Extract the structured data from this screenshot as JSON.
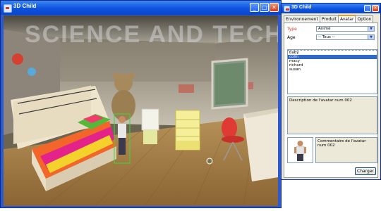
{
  "main_window": {
    "title": "3D Child",
    "watermark": "SCIENCE AND TECHNO"
  },
  "side_panel": {
    "title": "3D Child",
    "tabs": [
      "Environnement",
      "Produit",
      "Avatar",
      "Option"
    ],
    "active_tab": "Avatar",
    "type_label": "Type",
    "type_value": "Animé",
    "age_label": "Age",
    "age_value": "-- Tous --",
    "avatars": [
      "baby",
      "colin",
      "macy",
      "richard",
      "susan"
    ],
    "selected_avatar": "colin",
    "description": "Description de l'avatar num 002",
    "comment": "Commentaire de l'avatar num 002",
    "load_button": "Charger"
  },
  "colors": {
    "titlebar": "#0d52e0",
    "selection": "#316ac5",
    "panel_bg": "#ece9d8"
  }
}
